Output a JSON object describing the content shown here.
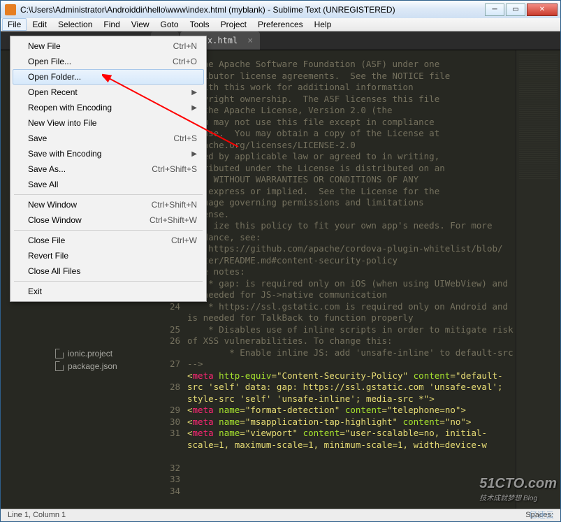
{
  "window": {
    "title": "C:\\Users\\Administrator\\Androiddir\\hello\\www\\index.html (myblank) - Sublime Text (UNREGISTERED)"
  },
  "menubar": [
    "File",
    "Edit",
    "Selection",
    "Find",
    "View",
    "Goto",
    "Tools",
    "Project",
    "Preferences",
    "Help"
  ],
  "tabs": [
    {
      "label": "",
      "active": false,
      "dirty": true
    },
    {
      "label": "index.html",
      "active": true,
      "dirty": false
    }
  ],
  "file_menu": [
    {
      "label": "New File",
      "shortcut": "Ctrl+N"
    },
    {
      "label": "Open File...",
      "shortcut": "Ctrl+O"
    },
    {
      "label": "Open Folder...",
      "hover": true
    },
    {
      "label": "Open Recent",
      "submenu": true
    },
    {
      "label": "Reopen with Encoding",
      "submenu": true
    },
    {
      "label": "New View into File"
    },
    {
      "label": "Save",
      "shortcut": "Ctrl+S"
    },
    {
      "label": "Save with Encoding",
      "submenu": true
    },
    {
      "label": "Save As...",
      "shortcut": "Ctrl+Shift+S"
    },
    {
      "label": "Save All"
    },
    {
      "sep": true
    },
    {
      "label": "New Window",
      "shortcut": "Ctrl+Shift+N"
    },
    {
      "label": "Close Window",
      "shortcut": "Ctrl+Shift+W"
    },
    {
      "sep": true
    },
    {
      "label": "Close File",
      "shortcut": "Ctrl+W"
    },
    {
      "label": "Revert File"
    },
    {
      "label": "Close All Files"
    },
    {
      "sep": true
    },
    {
      "label": "Exit"
    }
  ],
  "sidebar_items": [
    {
      "name": "ionic.project"
    },
    {
      "name": "package.json"
    }
  ],
  "code_lines": [
    {
      "n": "",
      "t": "o the Apache Software Foundation (ASF) under one"
    },
    {
      "n": "",
      "t": "ntributor license agreements.  See the NOTICE file"
    },
    {
      "n": "",
      "t": "d with this work for additional information"
    },
    {
      "n": "",
      "t": "copyright ownership.  The ASF licenses this file"
    },
    {
      "n": "",
      "t": "er the Apache License, Version 2.0 (the"
    },
    {
      "n": "",
      "t": " you may not use this file except in compliance"
    },
    {
      "n": "",
      "t": "icense.  You may obtain a copy of the License at"
    },
    {
      "n": "",
      "t": ""
    },
    {
      "n": "",
      "t": ".apache.org/licenses/LICENSE-2.0"
    },
    {
      "n": "",
      "t": ""
    },
    {
      "n": "",
      "t": "uired by applicable law or agreed to in writing,"
    },
    {
      "n": "",
      "t": "istributed under the License is distributed on an"
    },
    {
      "n": "",
      "t": "SIS, WITHOUT WARRANTIES OR CONDITIONS OF ANY"
    },
    {
      "n": "",
      "t": "her express or implied.  See the License for the"
    },
    {
      "n": "",
      "t": "anguage governing permissions and limitations"
    },
    {
      "n": "",
      "t": "License."
    },
    {
      "n": "",
      "t": ""
    },
    {
      "n": "",
      "t": ""
    },
    {
      "n": "",
      "t": ""
    },
    {
      "n": "",
      "t": "     ize this policy to fit your own app's needs. For more"
    },
    {
      "n": "",
      "t": "guidance, see:"
    },
    {
      "n": "24",
      "t": "    https://github.com/apache/cordova-plugin-whitelist/blob/"
    },
    {
      "n": "",
      "t": "master/README.md#content-security-policy"
    },
    {
      "n": "25",
      "t": "Some notes:"
    },
    {
      "n": "26",
      "t": "    * gap: is required only on iOS (when using UIWebView) and"
    },
    {
      "n": "",
      "t": "is needed for JS->native communication"
    },
    {
      "n": "27",
      "t": "    * https://ssl.gstatic.com is required only on Android and"
    },
    {
      "n": "",
      "t": "is needed for TalkBack to function properly"
    },
    {
      "n": "28",
      "t": "    * Disables use of inline scripts in order to mitigate risk"
    },
    {
      "n": "",
      "t": "of XSS vulnerabilities. To change this:"
    },
    {
      "n": "29",
      "t": "        * Enable inline JS: add 'unsafe-inline' to default-src"
    },
    {
      "n": "30",
      "t": "-->"
    },
    {
      "n": "31",
      "html": "&lt;<span class='kw'>meta</span> <span class='attr'>http-equiv</span>=<span class='str'>\"Content-Security-Policy\"</span> <span class='attr'>content</span>=<span class='str'>\"default-</span>"
    },
    {
      "n": "",
      "html": "<span class='str'>src 'self' data: gap: https://ssl.gstatic.com 'unsafe-eval';</span>"
    },
    {
      "n": "",
      "html": "<span class='str'>style-src 'self' 'unsafe-inline'; media-src *\"</span>&gt;"
    },
    {
      "n": "32",
      "html": "&lt;<span class='kw'>meta</span> <span class='attr'>name</span>=<span class='str'>\"format-detection\"</span> <span class='attr'>content</span>=<span class='str'>\"telephone=no\"</span>&gt;"
    },
    {
      "n": "33",
      "html": "&lt;<span class='kw'>meta</span> <span class='attr'>name</span>=<span class='str'>\"msapplication-tap-highlight\"</span> <span class='attr'>content</span>=<span class='str'>\"no\"</span>&gt;"
    },
    {
      "n": "34",
      "html": "&lt;<span class='kw'>meta</span> <span class='attr'>name</span>=<span class='str'>\"viewport\"</span> <span class='attr'>content</span>=<span class='str'>\"user-scalable=no, initial-</span>"
    },
    {
      "n": "",
      "html": "<span class='str'>scale=1, maximum-scale=1, minimum-scale=1, width=device-w</span>"
    }
  ],
  "status": {
    "left": "Line 1, Column 1",
    "spaces": "Spaces:"
  },
  "watermark": {
    "main": "51CTO.com",
    "sub": "技术成就梦想  Blog"
  },
  "cloud_wm": "亿速云"
}
